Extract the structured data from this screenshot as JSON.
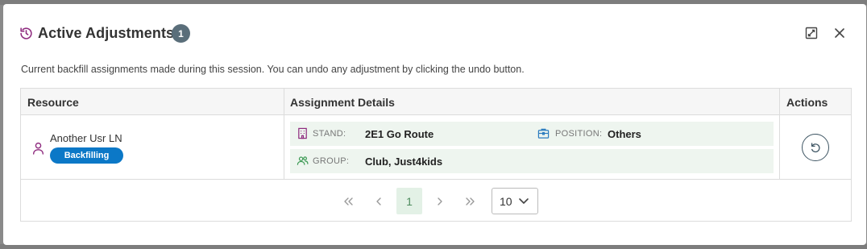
{
  "dialog": {
    "title": "Active Adjustments",
    "count": "1",
    "description": "Current backfill assignments made during this session. You can undo any adjustment by clicking the undo button."
  },
  "table": {
    "headers": {
      "resource": "Resource",
      "assignment_details": "Assignment Details",
      "actions": "Actions"
    },
    "rows": [
      {
        "resource_name": "Another Usr LN",
        "status": "Backfilling",
        "stand_label": "STAND:",
        "stand_value": "2E1 Go Route",
        "position_label": "POSITION:",
        "position_value": "Others",
        "group_label": "GROUP:",
        "group_value": "Club, Just4kids"
      }
    ]
  },
  "pagination": {
    "current_page": "1",
    "page_size": "10"
  },
  "icons": {
    "title": "history-icon",
    "expand": "expand-icon",
    "close": "close-icon",
    "resource": "user-icon",
    "stand": "building-icon",
    "position": "briefcase-icon",
    "group": "users-icon",
    "undo": "undo-icon"
  },
  "colors": {
    "accent_purple": "#8e2a7e",
    "badge_blue": "#0b78c7",
    "count_badge": "#5a6e7a",
    "detail_band": "#eef5ef",
    "group_green": "#3c9a54",
    "position_blue": "#2a7bbf"
  }
}
